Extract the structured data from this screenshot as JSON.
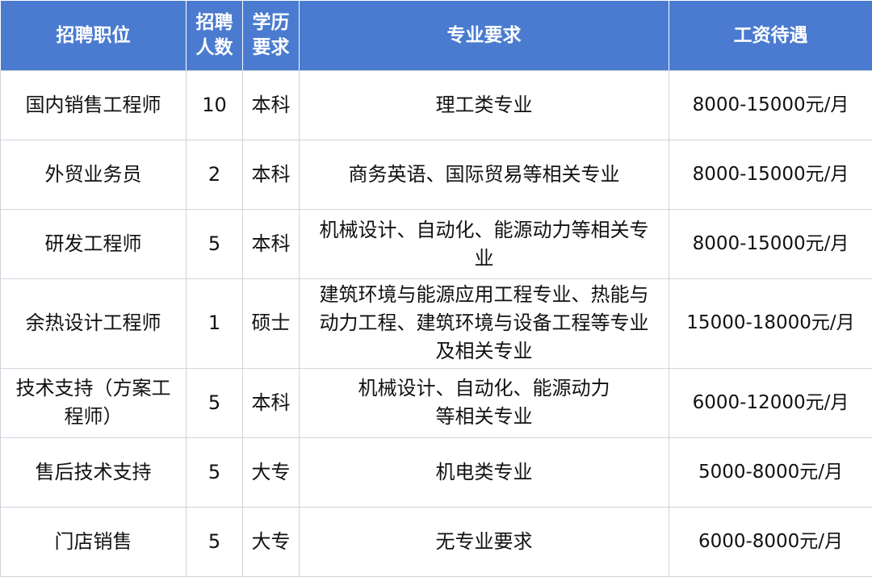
{
  "table": {
    "headers": {
      "position": "招聘职位",
      "count": [
        "招聘",
        "人数"
      ],
      "education": [
        "学历",
        "要求"
      ],
      "major": "专业要求",
      "salary": "工资待遇"
    },
    "rows": [
      {
        "position": [
          "国内销售工程师"
        ],
        "count": "10",
        "education": "本科",
        "major": [
          "理工类专业"
        ],
        "salary": "8000-15000元/月"
      },
      {
        "position": [
          "外贸业务员"
        ],
        "count": "2",
        "education": "本科",
        "major": [
          "商务英语、国际贸易等相关专业"
        ],
        "salary": "8000-15000元/月"
      },
      {
        "position": [
          "研发工程师"
        ],
        "count": "5",
        "education": "本科",
        "major": [
          "机械设计、自动化、能源动力等相关专",
          "业"
        ],
        "salary": "8000-15000元/月"
      },
      {
        "position": [
          "余热设计工程师"
        ],
        "count": "1",
        "education": "硕士",
        "major": [
          "建筑环境与能源应用工程专业、热能与",
          "动力工程、建筑环境与设备工程等专业",
          "及相关专业"
        ],
        "salary": "15000-18000元/月"
      },
      {
        "position": [
          "技术支持（方案工",
          "程师）"
        ],
        "count": "5",
        "education": "本科",
        "major": [
          "机械设计、自动化、能源动力",
          "等相关专业"
        ],
        "salary": "6000-12000元/月"
      },
      {
        "position": [
          "售后技术支持"
        ],
        "count": "5",
        "education": "大专",
        "major": [
          "机电类专业"
        ],
        "salary": "5000-8000元/月"
      },
      {
        "position": [
          "门店销售"
        ],
        "count": "5",
        "education": "大专",
        "major": [
          "无专业要求"
        ],
        "salary": "6000-8000元/月"
      }
    ]
  },
  "colors": {
    "header_bg": "#4a7bd0",
    "header_text": "#ffffff",
    "grid": "#cfd3da",
    "text": "#111111"
  }
}
